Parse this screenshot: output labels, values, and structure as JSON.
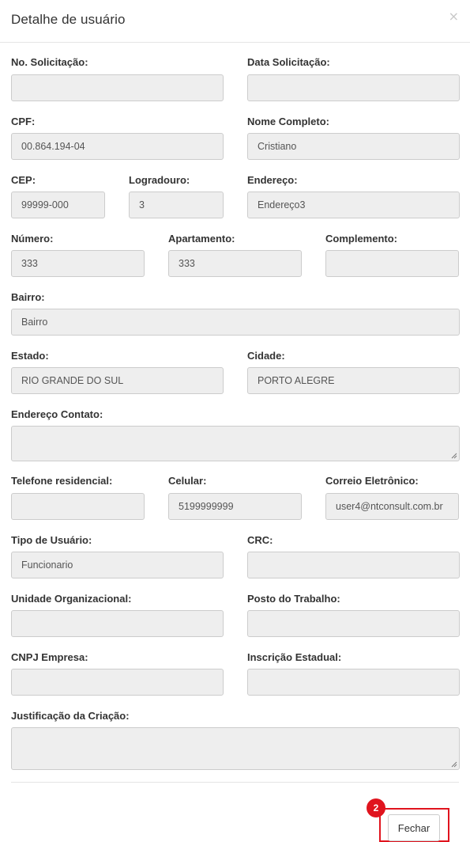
{
  "modal": {
    "title": "Detalhe de usuário",
    "close_symbol": "×",
    "close_icon": "close-icon"
  },
  "fields": {
    "no_solicitacao": {
      "label": "No. Solicitação:",
      "value": ""
    },
    "data_solicitacao": {
      "label": "Data Solicitação:",
      "value": ""
    },
    "cpf": {
      "label": "CPF:",
      "value": "00.864.194-04"
    },
    "nome_completo": {
      "label": "Nome Completo:",
      "value": "Cristiano"
    },
    "cep": {
      "label": "CEP:",
      "value": "99999-000"
    },
    "logradouro": {
      "label": "Logradouro:",
      "value": "3"
    },
    "endereco": {
      "label": "Endereço:",
      "value": "Endereço3"
    },
    "numero": {
      "label": "Número:",
      "value": "333"
    },
    "apartamento": {
      "label": "Apartamento:",
      "value": "333"
    },
    "complemento": {
      "label": "Complemento:",
      "value": ""
    },
    "bairro": {
      "label": "Bairro:",
      "value": "Bairro"
    },
    "estado": {
      "label": "Estado:",
      "value": "RIO GRANDE DO SUL"
    },
    "cidade": {
      "label": "Cidade:",
      "value": "PORTO ALEGRE"
    },
    "endereco_contato": {
      "label": "Endereço Contato:",
      "value": ""
    },
    "telefone_residencial": {
      "label": "Telefone residencial:",
      "value": ""
    },
    "celular": {
      "label": "Celular:",
      "value": "5199999999"
    },
    "correio_eletronico": {
      "label": "Correio Eletrônico:",
      "value": "user4@ntconsult.com.br"
    },
    "tipo_usuario": {
      "label": "Tipo de Usuário:",
      "value": "Funcionario"
    },
    "crc": {
      "label": "CRC:",
      "value": ""
    },
    "unidade_organizacional": {
      "label": "Unidade Organizacional:",
      "value": ""
    },
    "posto_trabalho": {
      "label": "Posto do Trabalho:",
      "value": ""
    },
    "cnpj_empresa": {
      "label": "CNPJ Empresa:",
      "value": ""
    },
    "inscricao_estadual": {
      "label": "Inscrição Estadual:",
      "value": ""
    },
    "justificacao": {
      "label": "Justificação da Criação:",
      "value": ""
    }
  },
  "footer": {
    "close_label": "Fechar",
    "annotation_number": "2",
    "annotation_color": "#e0141e"
  }
}
